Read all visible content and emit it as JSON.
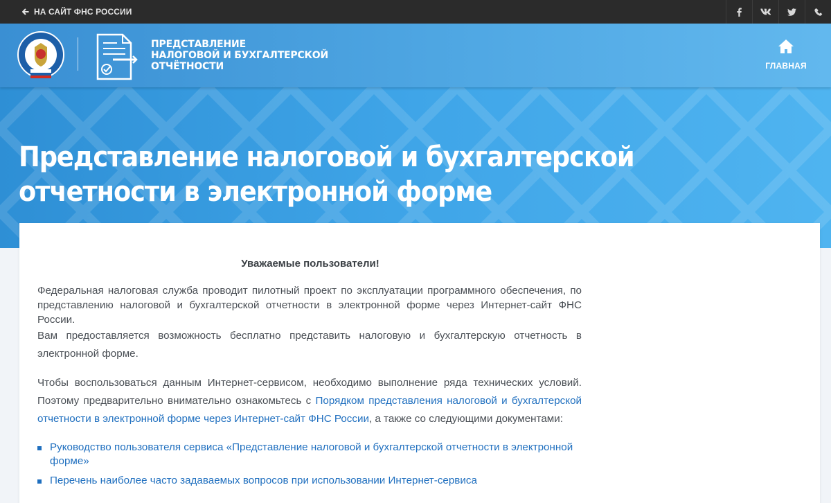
{
  "topbar": {
    "back_link": "НА САЙТ ФНС РОССИИ",
    "socials": [
      {
        "name": "facebook-icon",
        "glyph": "f"
      },
      {
        "name": "vk-icon",
        "glyph": "vk"
      },
      {
        "name": "twitter-icon",
        "glyph": "twitter"
      },
      {
        "name": "phone-icon",
        "glyph": "phone"
      }
    ]
  },
  "header": {
    "emblem_text": "ФЕДЕРАЛЬНАЯ НАЛОГОВАЯ СЛУЖБА",
    "service_title_lines": [
      "ПРЕДСТАВЛЕНИЕ",
      "НАЛОГОВОЙ И БУХГАЛТЕРСКОЙ",
      "ОТЧЁТНОСТИ"
    ],
    "home_label": "ГЛАВНАЯ"
  },
  "hero": {
    "title": "Представление налоговой и бухгалтерской отчетности в электронной форме"
  },
  "content": {
    "greeting": "Уважаемые пользователи!",
    "para1": "Федеральная налоговая служба проводит пилотный проект по эксплуатации программного обеспечения, по представлению налоговой и бухгалтерской отчетности в электронной форме через Интернет-сайт ФНС России.",
    "para2": "Вам предоставляется возможность бесплатно представить налоговую и бухгалтерскую отчетность в электронной форме.",
    "para3_before": "Чтобы воспользоваться данным Интернет-сервисом, необходимо выполнение ряда технических условий. Поэтому предварительно внимательно ознакомьтесь с ",
    "para3_link": "Порядком представления налоговой и бухгалтерской отчетности в электронной форме через Интернет-сайт ФНС России",
    "para3_after": ", а также со следующими документами:",
    "links": [
      "Руководство пользователя сервиса «Представление налоговой и бухгалтерской отчетности в электронной форме»",
      "Перечень наиболее часто задаваемых вопросов при использовании Интернет-сервиса"
    ]
  },
  "colors": {
    "topbar": "#2b2b2b",
    "header_start": "#3a8fd3",
    "header_end": "#62b8ee",
    "link": "#1f6fbf"
  }
}
